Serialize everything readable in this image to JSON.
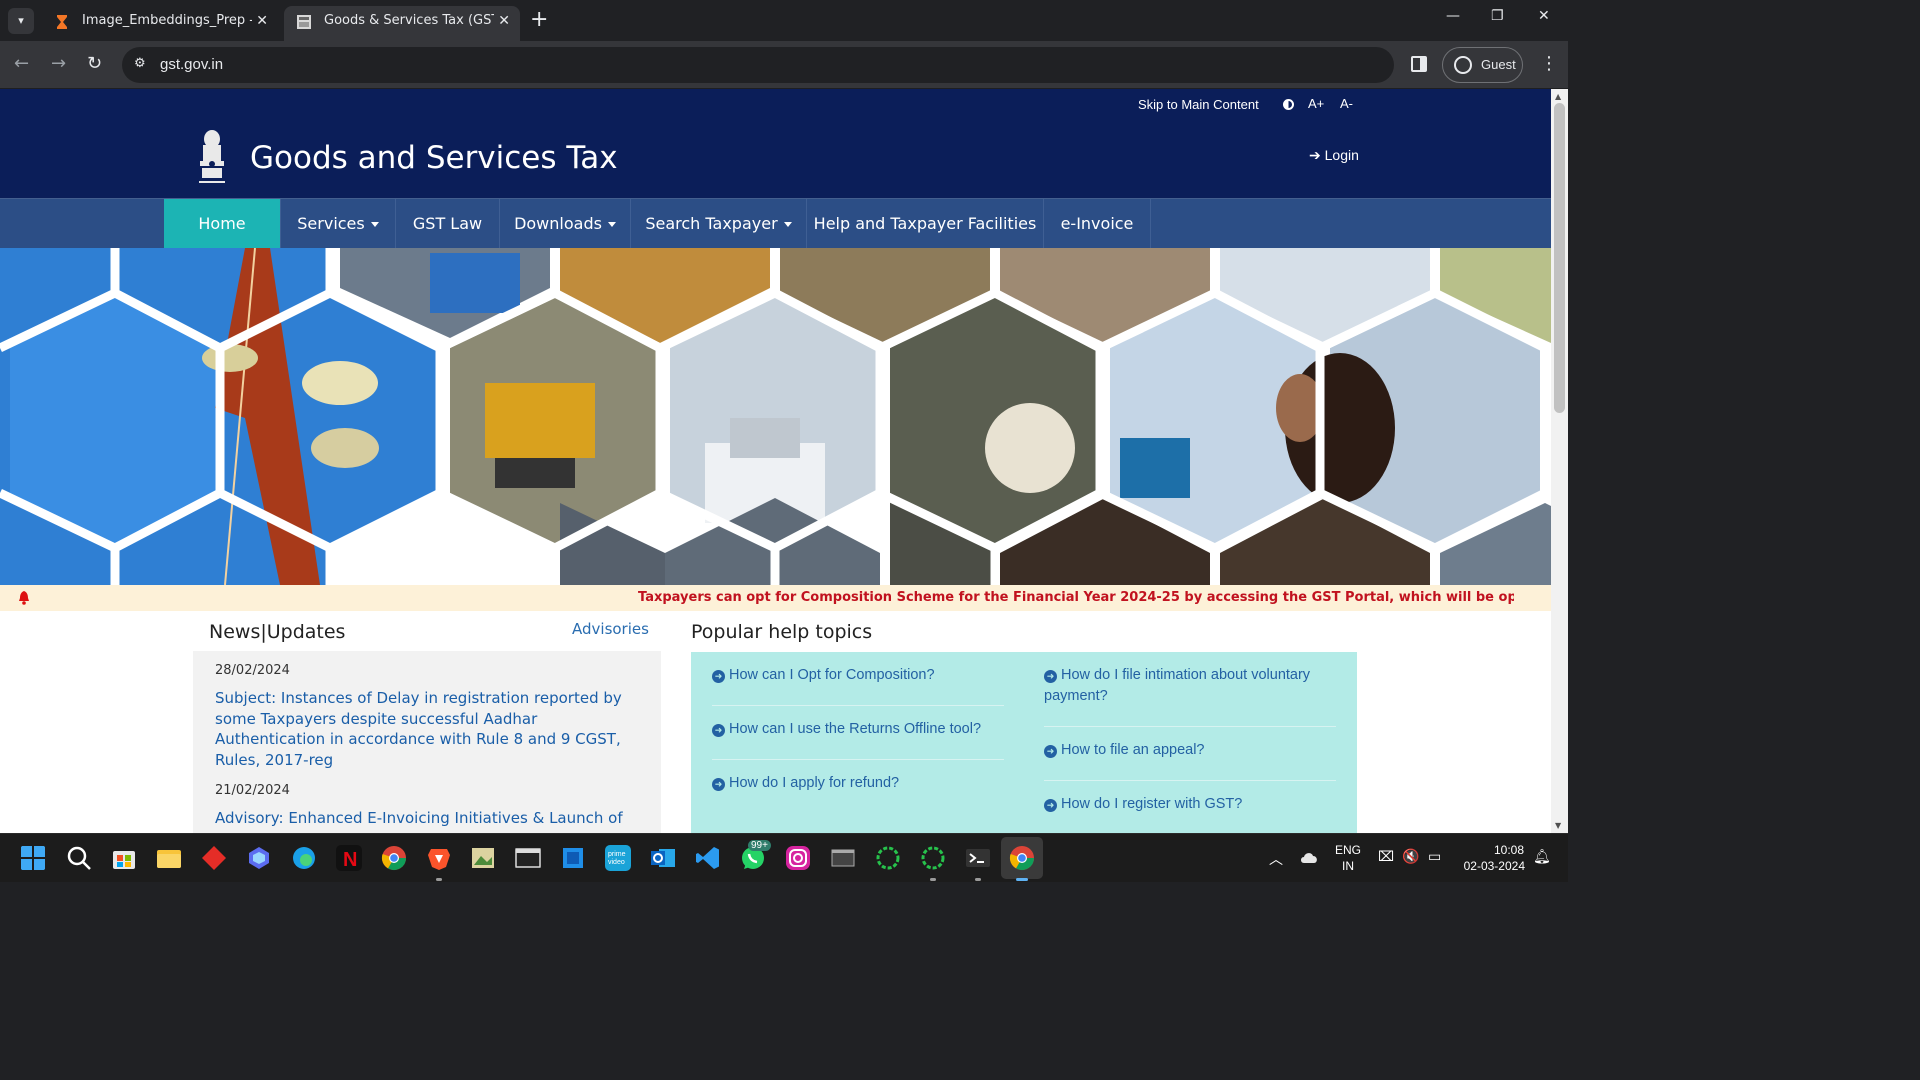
{
  "browser": {
    "tabs": [
      {
        "title": "Image_Embeddings_Prep - Jupyter",
        "active": false
      },
      {
        "title": "Goods & Services Tax (GST) | Home",
        "active": true
      }
    ],
    "url": "gst.gov.in",
    "profile": "Guest"
  },
  "accessibility": {
    "skip": "Skip to Main Content",
    "font_increase": "A+",
    "font_decrease": "A-"
  },
  "header": {
    "title": "Goods and Services Tax",
    "login": "Login"
  },
  "nav": [
    {
      "label": "Home",
      "dropdown": false
    },
    {
      "label": "Services",
      "dropdown": true
    },
    {
      "label": "GST Law",
      "dropdown": false
    },
    {
      "label": "Downloads",
      "dropdown": true
    },
    {
      "label": "Search Taxpayer",
      "dropdown": true
    },
    {
      "label": "Help and Taxpayer Facilities",
      "dropdown": false
    },
    {
      "label": "e-Invoice",
      "dropdown": false
    }
  ],
  "ticker": "Taxpayers can opt for Composition Scheme for the Financial Year 2024-25 by accessing the GST Portal, which will be open upto",
  "news": {
    "title": "News|Updates",
    "advisories": "Advisories",
    "items": [
      {
        "date": "28/02/2024",
        "text": "Subject: Instances of Delay in registration reported by some Taxpayers despite successful Aadhar Authentication in accordance with Rule 8 and 9 CGST, Rules, 2017-reg"
      },
      {
        "date": "21/02/2024",
        "text": "Advisory: Enhanced E-Invoicing Initiatives & Launch of"
      }
    ]
  },
  "help": {
    "title": "Popular help topics",
    "left": [
      "How can I Opt for Composition?",
      "How can I use the Returns Offline tool?",
      "How do I apply for refund?"
    ],
    "right": [
      "How do I file intimation about voluntary payment?",
      "How to file an appeal?",
      "How do I register with GST?"
    ]
  },
  "taskbar": {
    "whatsapp_badge": "99+",
    "lang_1": "ENG",
    "lang_2": "IN",
    "time": "10:08",
    "date": "02-03-2024"
  },
  "colors": {
    "header_bg": "#0b1e59",
    "nav_bg": "#2c4e86",
    "nav_active": "#1cb4b4",
    "ticker_text": "#c1121f",
    "help_bg": "#b3ebe7",
    "link": "#1a5ea8"
  }
}
